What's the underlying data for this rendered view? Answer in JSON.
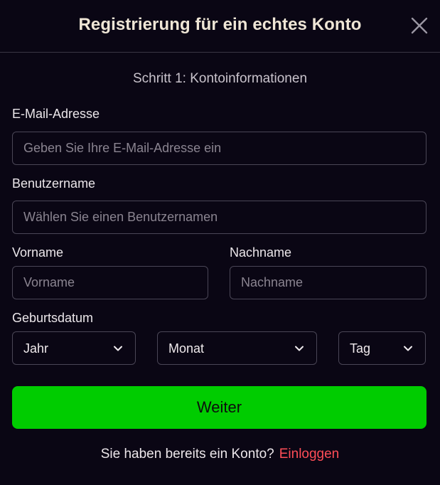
{
  "dialog": {
    "title": "Registrierung für ein echtes Konto",
    "close_icon": "close-icon"
  },
  "step": {
    "label": "Schritt 1: Kontoinformationen"
  },
  "form": {
    "email": {
      "label": "E-Mail-Adresse",
      "placeholder": "Geben Sie Ihre E-Mail-Adresse ein",
      "value": ""
    },
    "username": {
      "label": "Benutzername",
      "placeholder": "Wählen Sie einen Benutzernamen",
      "value": ""
    },
    "first_name": {
      "label": "Vorname",
      "placeholder": "Vorname",
      "value": ""
    },
    "last_name": {
      "label": "Nachname",
      "placeholder": "Nachname",
      "value": ""
    },
    "birthdate": {
      "label": "Geburtsdatum",
      "year": {
        "selected": "Jahr",
        "icon": "chevron-down-icon"
      },
      "month": {
        "selected": "Monat",
        "icon": "chevron-down-icon"
      },
      "day": {
        "selected": "Tag",
        "icon": "chevron-down-icon"
      }
    },
    "continue_label": "Weiter"
  },
  "footer": {
    "prompt": "Sie haben bereits ein Konto?",
    "login_label": "Einloggen"
  },
  "colors": {
    "background": "#0a0614",
    "primary_button": "#00cc00",
    "link": "#ff4d57",
    "border": "#4a4656"
  }
}
